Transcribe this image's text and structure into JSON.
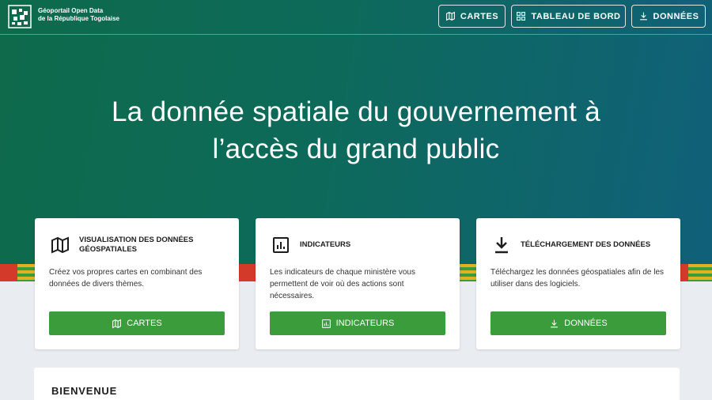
{
  "brand": {
    "line1": "Géoportail Open Data",
    "line2": "de la République Togolaise"
  },
  "nav": [
    {
      "label": "CARTES",
      "icon": "map-icon"
    },
    {
      "label": "TABLEAU DE BORD",
      "icon": "dashboard-icon"
    },
    {
      "label": "DONNÉES",
      "icon": "download-icon"
    }
  ],
  "hero": {
    "line1": "La donnée spatiale du gouvernement à",
    "line2": "l’accès du grand public"
  },
  "cards": [
    {
      "title": "VISUALISATION DES DONNÉES GÉOSPATIALES",
      "icon": "map-icon",
      "description": "Créez vos propres cartes en combinant des données de divers thèmes.",
      "button": "CARTES"
    },
    {
      "title": "INDICATEURS",
      "icon": "chart-icon",
      "description": "Les indicateurs de chaque ministère vous permettent de voir où des actions sont nécessaires.",
      "button": "INDICATEURS"
    },
    {
      "title": "TÉLÉCHARGEMENT DES DONNÉES",
      "icon": "download-icon",
      "description": "Téléchargez les données géospatiales afin de les utiliser dans des logiciels.",
      "button": "DONNÉES"
    }
  ],
  "welcome": {
    "title": "BIENVENUE"
  },
  "colors": {
    "accent": "#3a9c3b",
    "hero_start": "#0e6a4a",
    "hero_end": "#10607a"
  }
}
